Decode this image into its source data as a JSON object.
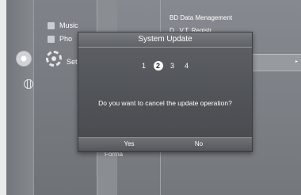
{
  "menu": {
    "items": [
      {
        "label": "Music",
        "icon": "music-icon"
      },
      {
        "label": "Pho",
        "icon": "photo-icon"
      },
      {
        "label": "Set",
        "icon": "gear-icon"
      }
    ],
    "sub_items": [
      {
        "label": "BD Data Menagement"
      },
      {
        "label": "D.. V.T. Registr"
      }
    ],
    "partial_bg_text": "Forma"
  },
  "dialog": {
    "title": "System Update",
    "steps": [
      "1",
      "2",
      "3",
      "4"
    ],
    "active_step": "2",
    "message": "Do you want to cancel the update operation?",
    "yes_label": "Yes",
    "no_label": "No"
  },
  "icons": {
    "disc": "disc-icon",
    "gear": "gear-icon",
    "globe": "globe-icon"
  }
}
